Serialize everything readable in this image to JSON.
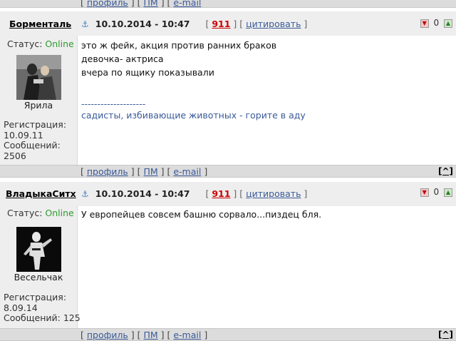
{
  "top_bar": {
    "bracket_open": "[",
    "profile": "профиль",
    "pm": "ПМ",
    "email": "e-mail",
    "sep": "] [",
    "bracket_close": "]"
  },
  "posts": [
    {
      "author": "Борменталь",
      "date": "10.10.2014 - 10:47",
      "post_number": "911",
      "quote_label": "цитировать",
      "rating": "0",
      "status_label": "Статус:",
      "status_value": "Online",
      "avatar_title": "Ярила",
      "reg_label": "Регистрация:",
      "reg_date": "10.09.11",
      "messages_label": "Сообщений:",
      "messages_count": "2506",
      "lines": [
        "это ж фейк, акция против ранних браков",
        "девочка- актриса",
        "вчера по ящику показывали"
      ],
      "signature_sep": "--------------------",
      "signature": "садисты, избивающие животных - горите в аду",
      "footer": {
        "profile": "профиль",
        "pm": "ПМ",
        "email": "e-mail",
        "up": "[^]"
      }
    },
    {
      "author": "ВладыкаСитх",
      "date": "10.10.2014 - 10:47",
      "post_number": "911",
      "quote_label": "цитировать",
      "rating": "0",
      "status_label": "Статус:",
      "status_value": "Online",
      "avatar_title": "Весельчак",
      "reg_label": "Регистрация:",
      "reg_date": "8.09.14",
      "messages_label": "Сообщений:",
      "messages_count": "125",
      "lines": [
        "У европейцев совсем башню сорвало...пиздец бля."
      ],
      "footer": {
        "profile": "профиль",
        "pm": "ПМ",
        "email": "e-mail",
        "up": "[^]"
      }
    }
  ],
  "colors": {
    "online": "#2e9b2e",
    "post_number": "#cc0000",
    "link": "#3a5a98",
    "header_bg": "#eeeeee",
    "bar_bg": "#dcdcdc"
  },
  "icons": {
    "anchor": "anchor-icon",
    "rate_down": "rate-down-icon",
    "rate_up": "rate-up-icon",
    "up_arrow": "scroll-up-icon"
  }
}
